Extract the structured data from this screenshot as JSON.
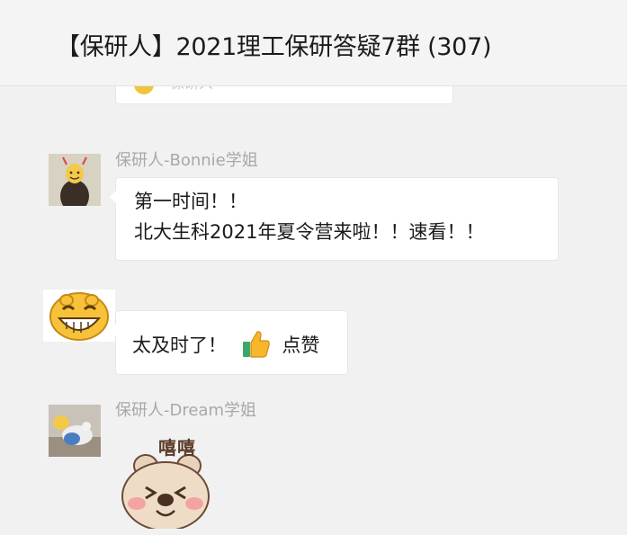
{
  "header": {
    "title": "【保研人】2021理工保研答疑7群 (307)"
  },
  "messages": [
    {
      "type": "partial-card",
      "text": "保研人"
    },
    {
      "sender": "保研人-Bonnie学姐",
      "lines": [
        "第一时间！！",
        "北大生科2021年夏令营来啦！！速看！！"
      ]
    },
    {
      "sender": "",
      "text_before": "太及时了！",
      "emoji": "thumbs-up-icon",
      "text_after": "点赞"
    },
    {
      "sender": "保研人-Dream学姐",
      "sticker": {
        "text": "嘻嘻",
        "name": "bear-sticker"
      }
    }
  ],
  "colors": {
    "background": "#f1f1f1",
    "bubble": "#ffffff",
    "sender": "#a8a8a8"
  }
}
